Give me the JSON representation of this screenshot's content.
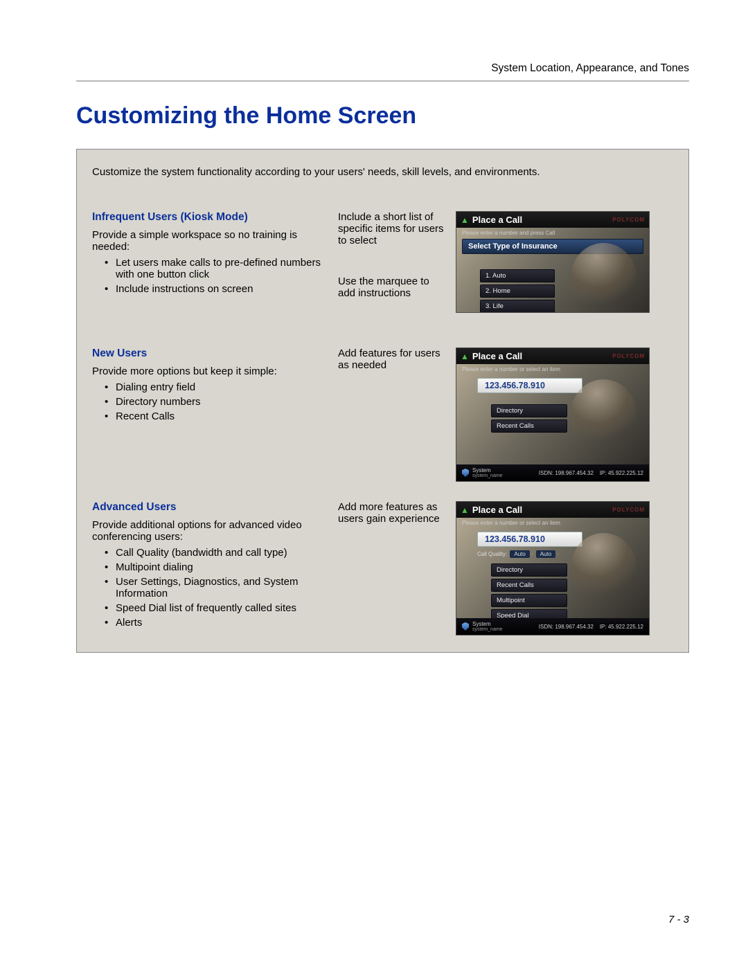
{
  "header": {
    "breadcrumb": "System Location, Appearance, and Tones",
    "title": "Customizing the Home Screen",
    "page_number": "7 - 3"
  },
  "intro": "Customize the system functionality according to your users' needs, skill levels, and environments.",
  "rows": [
    {
      "section_title": "Infrequent Users (Kiosk Mode)",
      "desc": "Provide a simple workspace so no training is needed:",
      "bullets": [
        "Let users make calls to pre-defined numbers with one button click",
        "Include instructions on screen"
      ],
      "mid_a": "Include a short list of specific items for users to select",
      "mid_b": "Use the marquee to add instructions",
      "shot": {
        "title": "Place a Call",
        "brand": "POLYCOM",
        "hint": "Please enter a number and press Call",
        "banner": "Select Type of Insurance",
        "items": [
          "1. Auto",
          "2. Home",
          "3. Life"
        ]
      }
    },
    {
      "section_title": "New Users",
      "desc": "Provide more options but keep it simple:",
      "bullets": [
        "Dialing entry field",
        "Directory numbers",
        "Recent Calls"
      ],
      "mid_a": "Add features for users as needed",
      "shot": {
        "title": "Place a Call",
        "brand": "POLYCOM",
        "hint": "Please enter a number or select an item",
        "input": "123.456.78.910",
        "menu": [
          "Directory",
          "Recent Calls"
        ],
        "footer_left": "System",
        "footer_sub": "system_name",
        "footer_mid": "ISDN: 198.967.454.32",
        "footer_right": "IP: 45.922.225.12"
      }
    },
    {
      "section_title": "Advanced Users",
      "desc": "Provide additional options for advanced video conferencing users:",
      "bullets": [
        "Call Quality (bandwidth and call type)",
        "Multipoint dialing",
        "User Settings, Diagnostics, and System Information",
        "Speed Dial list of frequently called sites",
        "Alerts"
      ],
      "mid_a": "Add more features as users gain experience",
      "shot": {
        "title": "Place a Call",
        "brand": "POLYCOM",
        "hint": "Please enter a number or select an item",
        "input": "123.456.78.910",
        "call_quality_label": "Call Quality:",
        "call_quality_a": "Auto",
        "call_quality_b": "Auto",
        "menu": [
          "Directory",
          "Recent Calls",
          "Multipoint",
          "Speed Dial"
        ],
        "footer_left": "System",
        "footer_sub": "system_name",
        "footer_mid": "ISDN: 198.967.454.32",
        "footer_right": "IP: 45.922.225.12"
      }
    }
  ]
}
